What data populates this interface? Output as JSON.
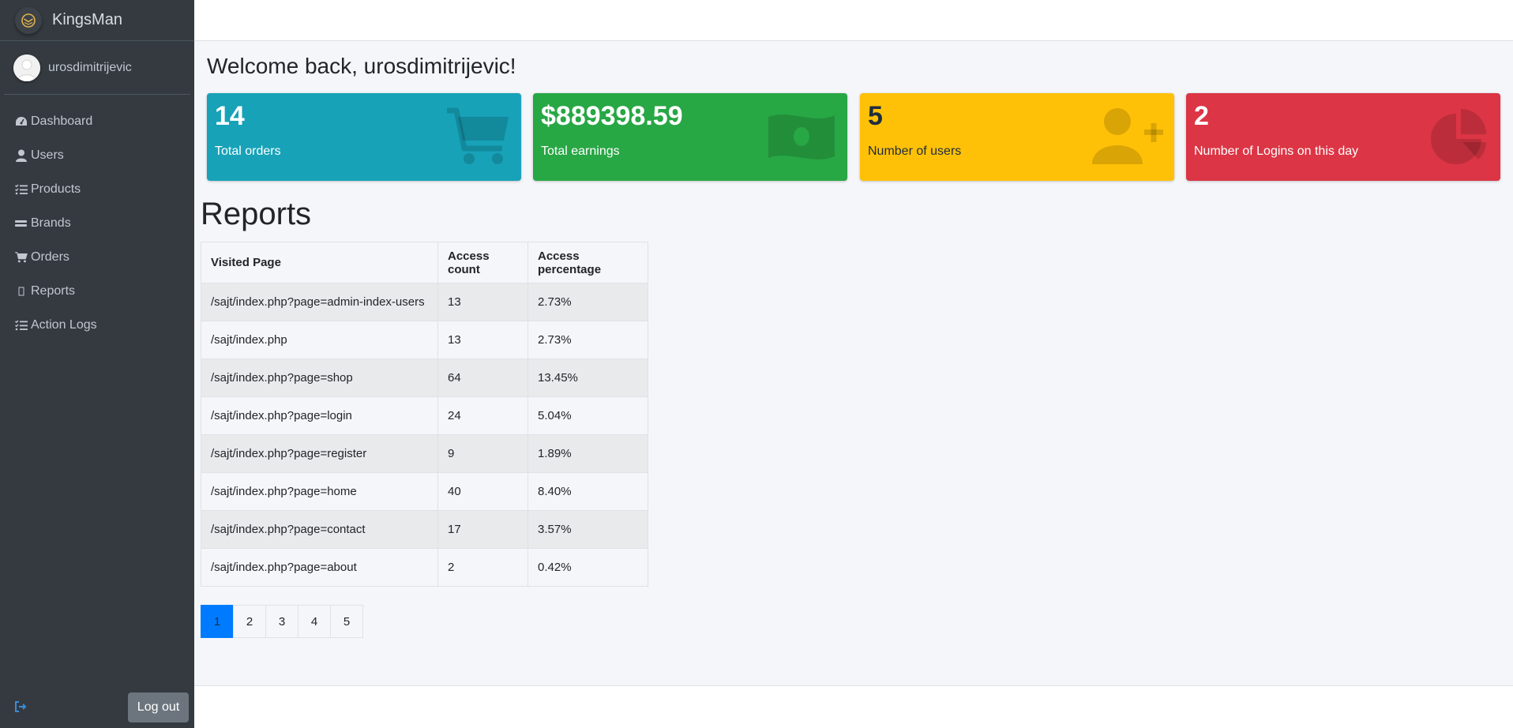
{
  "brand": {
    "name": "KingsMan"
  },
  "user": {
    "name": "urosdimitrijevic"
  },
  "sidebar": {
    "items": [
      {
        "label": "Dashboard",
        "icon": "dashboard-icon"
      },
      {
        "label": "Users",
        "icon": "user-icon"
      },
      {
        "label": "Products",
        "icon": "list-check-icon"
      },
      {
        "label": "Brands",
        "icon": "grip-lines-icon"
      },
      {
        "label": "Orders",
        "icon": "cart-icon"
      },
      {
        "label": "Reports",
        "icon": "missing-glyph-icon"
      },
      {
        "label": "Action Logs",
        "icon": "list-check-icon"
      }
    ],
    "logout_label": "Log out"
  },
  "main": {
    "welcome": "Welcome back, urosdimitrijevic!",
    "stats": [
      {
        "value": "14",
        "label": "Total orders",
        "icon": "shopping-cart-icon",
        "color": "#17a2b8"
      },
      {
        "value": "$889398.59",
        "label": "Total earnings",
        "icon": "money-bill-icon",
        "color": "#28a745"
      },
      {
        "value": "5",
        "label": "Number of users",
        "icon": "user-plus-icon",
        "color": "#ffc107"
      },
      {
        "value": "2",
        "label": "Number of Logins on this day",
        "icon": "chart-pie-icon",
        "color": "#dc3545"
      }
    ],
    "reports_title": "Reports",
    "table": {
      "headers": [
        "Visited Page",
        "Access count",
        "Access percentage"
      ],
      "rows": [
        [
          "/sajt/index.php?page=admin-index-users",
          "13",
          "2.73%"
        ],
        [
          "/sajt/index.php",
          "13",
          "2.73%"
        ],
        [
          "/sajt/index.php?page=shop",
          "64",
          "13.45%"
        ],
        [
          "/sajt/index.php?page=login",
          "24",
          "5.04%"
        ],
        [
          "/sajt/index.php?page=register",
          "9",
          "1.89%"
        ],
        [
          "/sajt/index.php?page=home",
          "40",
          "8.40%"
        ],
        [
          "/sajt/index.php?page=contact",
          "17",
          "3.57%"
        ],
        [
          "/sajt/index.php?page=about",
          "2",
          "0.42%"
        ]
      ]
    },
    "pagination": {
      "pages": [
        "1",
        "2",
        "3",
        "4",
        "5"
      ],
      "active": "1"
    }
  }
}
